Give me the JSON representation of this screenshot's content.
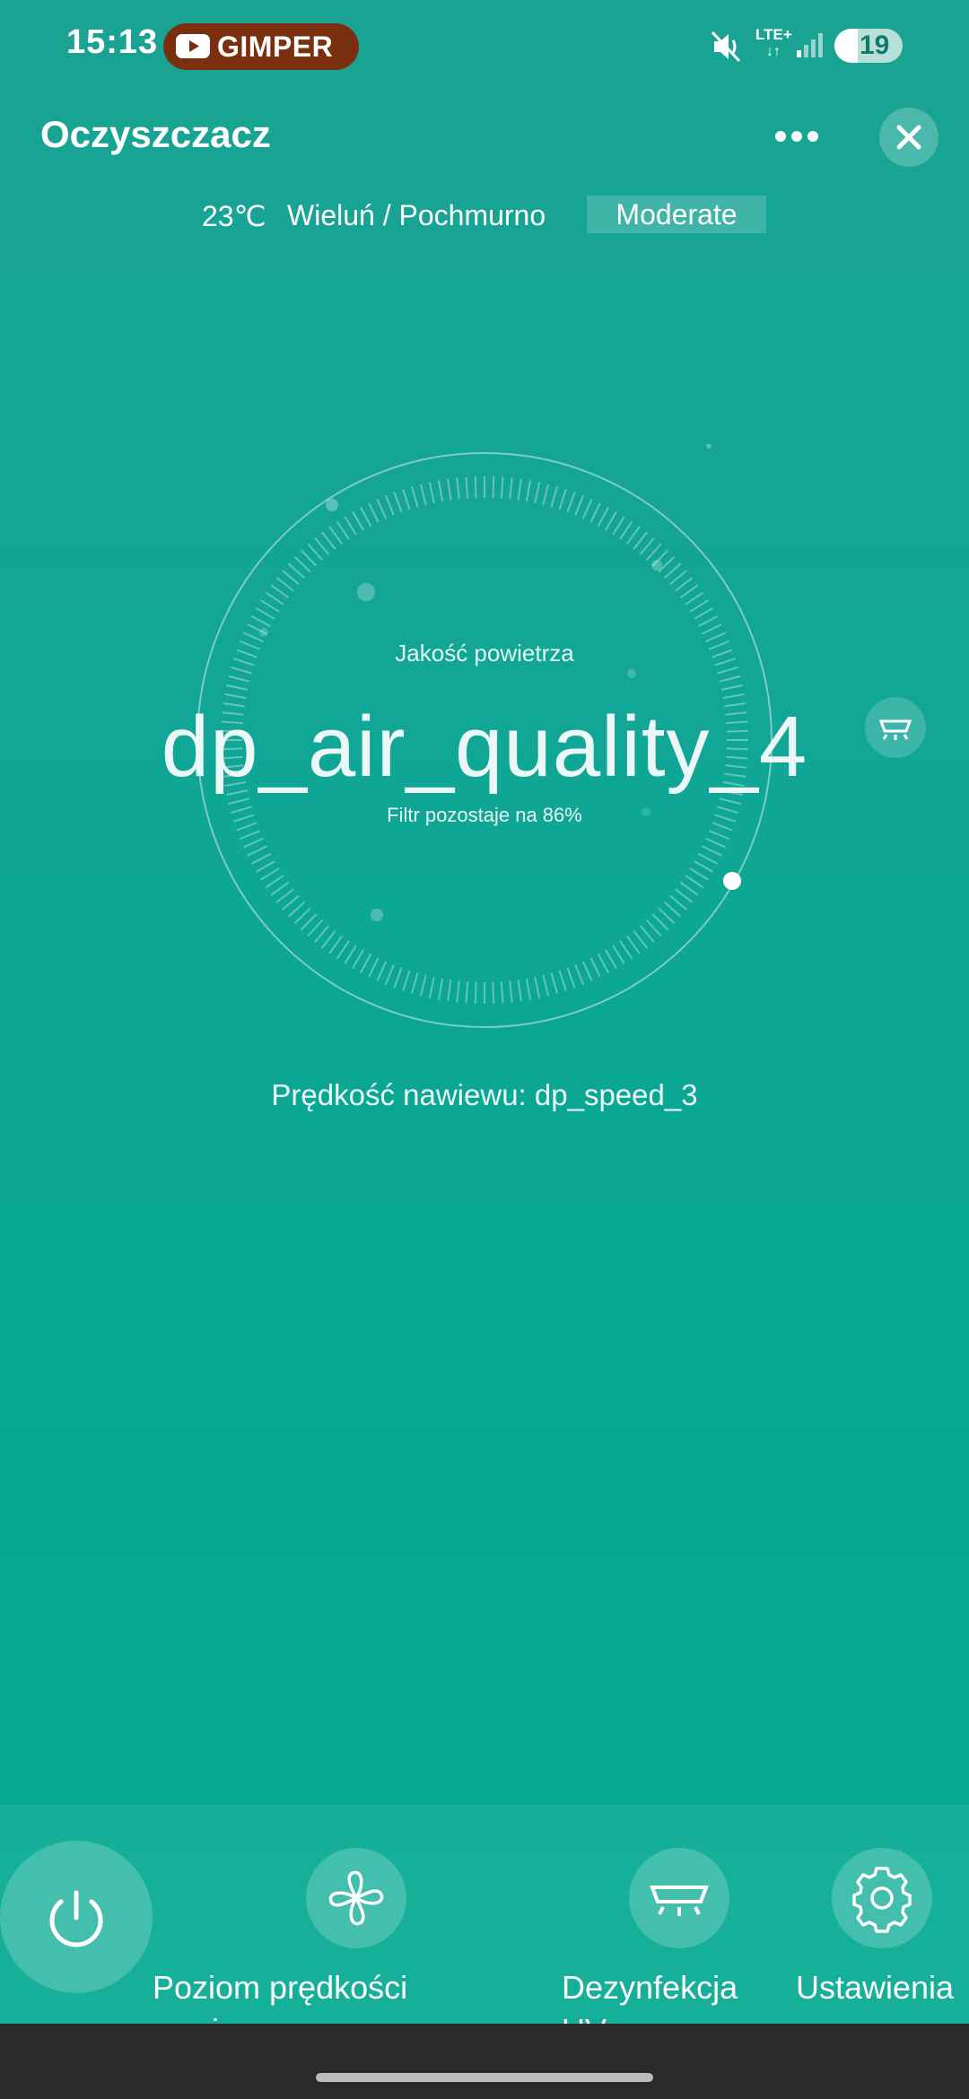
{
  "status_bar": {
    "time": "15:13",
    "youtube_chip": "GIMPER",
    "network": "LTE+",
    "battery": "19"
  },
  "header": {
    "title": "Oczyszczacz"
  },
  "weather": {
    "temperature": "23℃",
    "location": "Wieluń / Pochmurno",
    "air_status": "Moderate"
  },
  "dial": {
    "label": "Jakość powietrza",
    "value": "dp_air_quality_4",
    "filter": "Filtr pozostaje na 86%"
  },
  "speed": {
    "text": "Prędkość nawiewu: dp_speed_3"
  },
  "bottom_bar": {
    "fan_label": "Poziom prędkości nawiewu",
    "uv_label": "Dezynfekcja UV",
    "settings_label": "Ustawienia"
  },
  "colors": {
    "background_top": "#1aa393",
    "background_bottom": "#09ad95",
    "youtube_chip": "#7a2f0f"
  },
  "icons": [
    "youtube-icon",
    "mute-icon",
    "signal-icon",
    "more-icon",
    "close-icon",
    "uv-lamp-icon",
    "power-icon",
    "fan-icon",
    "gear-icon"
  ]
}
